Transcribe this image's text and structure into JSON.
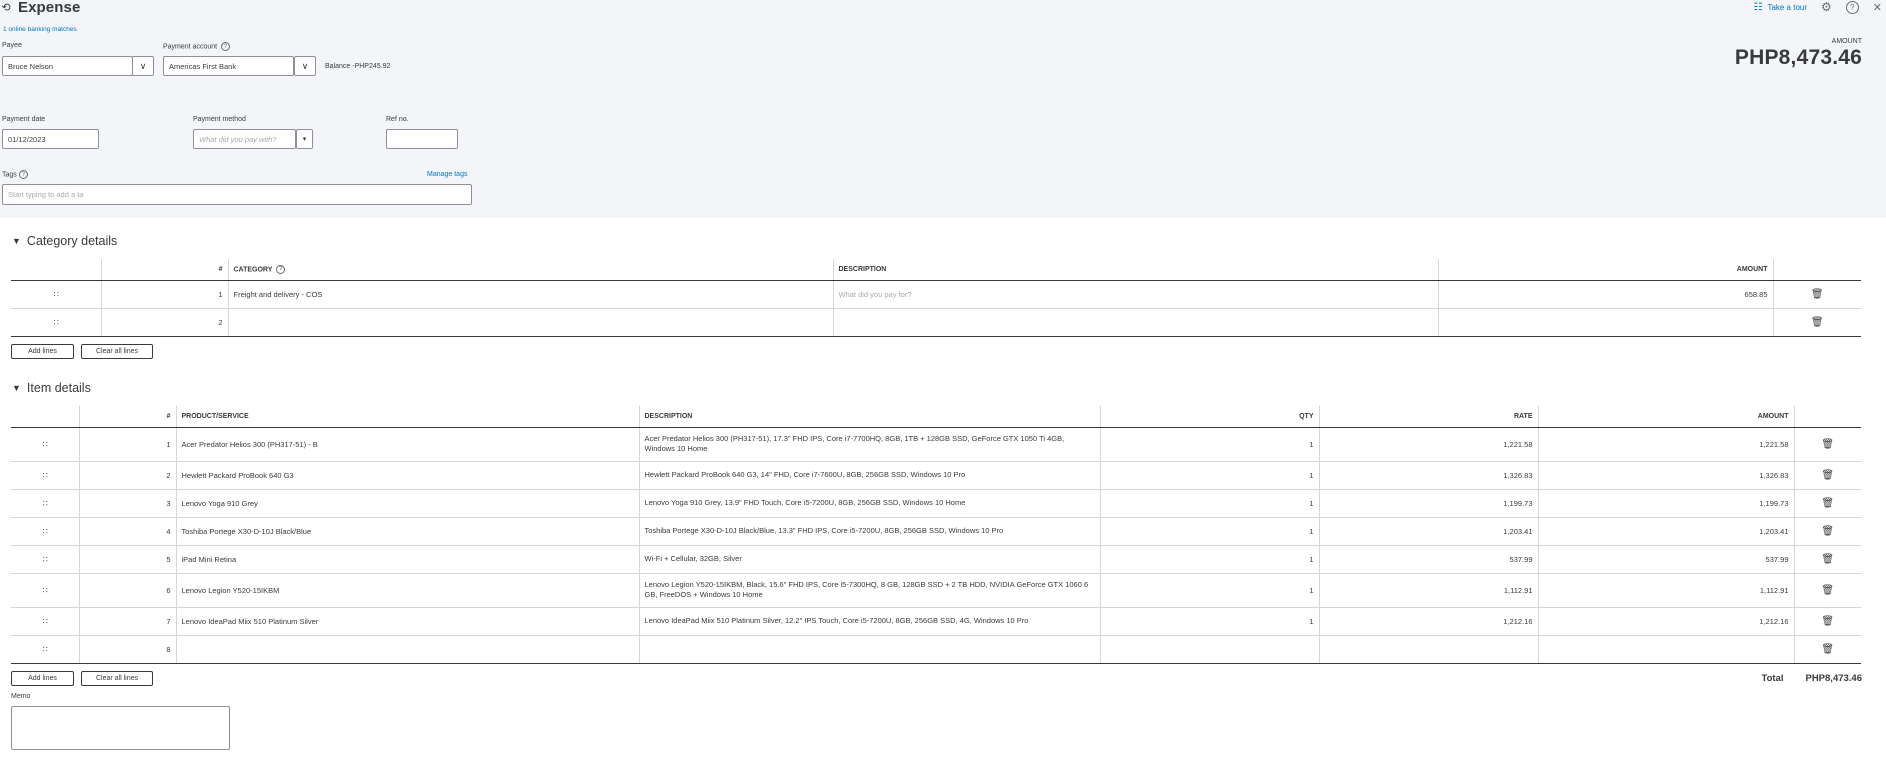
{
  "header": {
    "title": "Expense",
    "history_icon": "history-icon",
    "banking_link": "1 online banking matches",
    "tour_link": "Take a tour",
    "tour_icon": "tour-icon",
    "settings_icon": "gear-icon",
    "help_icon": "help-icon",
    "close_icon": "close-icon"
  },
  "form": {
    "payee_label": "Payee",
    "payee_value": "Bruce Nelson",
    "payment_account_label": "Payment account",
    "payment_account_value": "Americas First Bank",
    "balance_text": "Balance -PHP245.92",
    "payment_date_label": "Payment date",
    "payment_date_value": "01/12/2023",
    "payment_method_label": "Payment method",
    "payment_method_placeholder": "What did you pay with?",
    "ref_no_label": "Ref no.",
    "ref_no_value": "",
    "tags_label": "Tags",
    "manage_tags": "Manage tags",
    "tags_placeholder": "Start typing to add a ta"
  },
  "amount": {
    "label": "AMOUNT",
    "value": "PHP8,473.46"
  },
  "category_details": {
    "title": "Category details",
    "headers": {
      "num": "#",
      "category": "CATEGORY",
      "description": "DESCRIPTION",
      "amount": "AMOUNT"
    },
    "rows": [
      {
        "num": "1",
        "category": "Freight and delivery - COS",
        "description": "",
        "description_placeholder": "What did you pay for?",
        "amount": "658.85"
      },
      {
        "num": "2",
        "category": "",
        "description": "",
        "description_placeholder": "",
        "amount": ""
      }
    ],
    "add_lines": "Add lines",
    "clear_all_lines": "Clear all lines"
  },
  "item_details": {
    "title": "Item details",
    "headers": {
      "num": "#",
      "product": "PRODUCT/SERVICE",
      "description": "DESCRIPTION",
      "qty": "QTY",
      "rate": "RATE",
      "amount": "AMOUNT"
    },
    "rows": [
      {
        "num": "1",
        "product": "Acer Predator Helios 300 (PH317-51) - B",
        "description": "Acer Predator Helios 300 (PH317-51), 17.3\" FHD IPS, Core i7-7700HQ, 8GB, 1TB + 128GB SSD, GeForce GTX 1050 Ti 4GB, Windows 10 Home",
        "qty": "1",
        "rate": "1,221.58",
        "amount": "1,221.58"
      },
      {
        "num": "2",
        "product": "Hewlett Packard ProBook 640 G3",
        "description": "Hewlett Packard ProBook 640 G3, 14\" FHD, Core i7-7600U, 8GB, 256GB SSD, Windows 10 Pro",
        "qty": "1",
        "rate": "1,326.83",
        "amount": "1,326.83"
      },
      {
        "num": "3",
        "product": "Lenovo Yoga 910 Grey",
        "description": "Lenovo Yoga 910 Grey, 13.9\" FHD Touch, Core i5-7200U, 8GB, 256GB SSD, Windows 10 Home",
        "qty": "1",
        "rate": "1,199.73",
        "amount": "1,199.73"
      },
      {
        "num": "4",
        "product": "Toshiba Portege X30-D-10J Black/Blue",
        "description": "Toshiba Portege X30-D-10J Black/Blue, 13.3\" FHD IPS, Core i5-7200U, 8GB, 256GB SSD, Windows 10 Pro",
        "qty": "1",
        "rate": "1,203.41",
        "amount": "1,203.41"
      },
      {
        "num": "5",
        "product": "iPad Mini Retina",
        "description": "Wi-Fi + Cellular, 32GB, Silver",
        "qty": "1",
        "rate": "537.99",
        "amount": "537.99"
      },
      {
        "num": "6",
        "product": "Lenovo Legion Y520-15IKBM",
        "description": "Lenovo Legion Y520-15IKBM, Black, 15.6\" FHD IPS, Core i5-7300HQ, 8 GB, 128GB SSD + 2 TB HDD, NVIDIA GeForce GTX 1060 6 GB, FreeDOS + Windows 10 Home",
        "qty": "1",
        "rate": "1,112.91",
        "amount": "1,112.91"
      },
      {
        "num": "7",
        "product": "Lenovo IdeaPad Miix 510 Platinum Silver",
        "description": "Lenovo IdeaPad Miix 510 Platinum Silver, 12.2\" IPS Touch, Core i5-7200U, 8GB, 256GB SSD, 4G, Windows 10 Pro",
        "qty": "1",
        "rate": "1,212.16",
        "amount": "1,212.16"
      },
      {
        "num": "8",
        "product": "",
        "description": "",
        "qty": "",
        "rate": "",
        "amount": ""
      }
    ],
    "add_lines": "Add lines",
    "clear_all_lines": "Clear all lines"
  },
  "footer": {
    "total_label": "Total",
    "total_value": "PHP8,473.46",
    "memo_label": "Memo"
  }
}
